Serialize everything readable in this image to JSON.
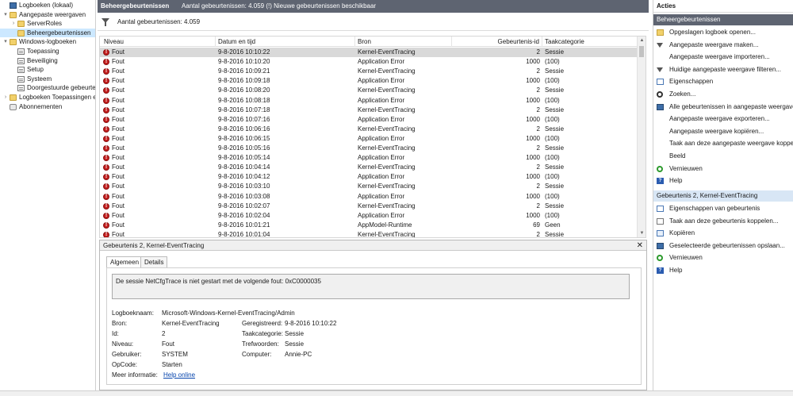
{
  "tree": {
    "items": [
      {
        "label": "Logboeken (lokaal)",
        "level": 0,
        "arrow": "",
        "icon": "root",
        "icon_name": "computer-icon"
      },
      {
        "label": "Aangepaste weergaven",
        "level": 0,
        "arrow": "▾",
        "icon": "folder",
        "icon_name": "folder-icon"
      },
      {
        "label": "ServerRoles",
        "level": 1,
        "arrow": "›",
        "icon": "folder",
        "icon_name": "folder-icon"
      },
      {
        "label": "Beheergebeurtenissen",
        "level": 1,
        "arrow": "",
        "icon": "folder",
        "icon_name": "filter-folder-icon",
        "selected": true
      },
      {
        "label": "Windows-logboeken",
        "level": 0,
        "arrow": "▾",
        "icon": "folder",
        "icon_name": "folder-icon"
      },
      {
        "label": "Toepassing",
        "level": 1,
        "arrow": "",
        "icon": "log",
        "icon_name": "log-icon"
      },
      {
        "label": "Beveiliging",
        "level": 1,
        "arrow": "",
        "icon": "log",
        "icon_name": "log-icon"
      },
      {
        "label": "Setup",
        "level": 1,
        "arrow": "",
        "icon": "log",
        "icon_name": "log-icon"
      },
      {
        "label": "Systeem",
        "level": 1,
        "arrow": "",
        "icon": "log",
        "icon_name": "log-icon"
      },
      {
        "label": "Doorgestuurde gebeurtenissen",
        "level": 1,
        "arrow": "",
        "icon": "log",
        "icon_name": "log-icon"
      },
      {
        "label": "Logboeken Toepassingen en services",
        "level": 0,
        "arrow": "›",
        "icon": "folder",
        "icon_name": "folder-icon"
      },
      {
        "label": "Abonnementen",
        "level": 0,
        "arrow": "",
        "icon": "sub",
        "icon_name": "subscription-icon"
      }
    ]
  },
  "center": {
    "title": "Beheergebeurtenissen",
    "title_info": "Aantal gebeurtenissen: 4.059 (!) Nieuwe gebeurtenissen beschikbaar",
    "filter_text": "Aantal gebeurtenissen: 4.059",
    "columns": [
      "Niveau",
      "Datum en tijd",
      "Bron",
      "Gebeurtenis-id",
      "Taakcategorie"
    ],
    "rows": [
      {
        "niveau": "Fout",
        "datum": "9-8-2016 10:10:22",
        "bron": "Kernel-EventTracing",
        "id": "2",
        "taak": "Sessie",
        "selected": true
      },
      {
        "niveau": "Fout",
        "datum": "9-8-2016 10:10:20",
        "bron": "Application Error",
        "id": "1000",
        "taak": "(100)"
      },
      {
        "niveau": "Fout",
        "datum": "9-8-2016 10:09:21",
        "bron": "Kernel-EventTracing",
        "id": "2",
        "taak": "Sessie"
      },
      {
        "niveau": "Fout",
        "datum": "9-8-2016 10:09:18",
        "bron": "Application Error",
        "id": "1000",
        "taak": "(100)"
      },
      {
        "niveau": "Fout",
        "datum": "9-8-2016 10:08:20",
        "bron": "Kernel-EventTracing",
        "id": "2",
        "taak": "Sessie"
      },
      {
        "niveau": "Fout",
        "datum": "9-8-2016 10:08:18",
        "bron": "Application Error",
        "id": "1000",
        "taak": "(100)"
      },
      {
        "niveau": "Fout",
        "datum": "9-8-2016 10:07:18",
        "bron": "Kernel-EventTracing",
        "id": "2",
        "taak": "Sessie"
      },
      {
        "niveau": "Fout",
        "datum": "9-8-2016 10:07:16",
        "bron": "Application Error",
        "id": "1000",
        "taak": "(100)"
      },
      {
        "niveau": "Fout",
        "datum": "9-8-2016 10:06:16",
        "bron": "Kernel-EventTracing",
        "id": "2",
        "taak": "Sessie"
      },
      {
        "niveau": "Fout",
        "datum": "9-8-2016 10:06:15",
        "bron": "Application Error",
        "id": "1000",
        "taak": "(100)"
      },
      {
        "niveau": "Fout",
        "datum": "9-8-2016 10:05:16",
        "bron": "Kernel-EventTracing",
        "id": "2",
        "taak": "Sessie"
      },
      {
        "niveau": "Fout",
        "datum": "9-8-2016 10:05:14",
        "bron": "Application Error",
        "id": "1000",
        "taak": "(100)"
      },
      {
        "niveau": "Fout",
        "datum": "9-8-2016 10:04:14",
        "bron": "Kernel-EventTracing",
        "id": "2",
        "taak": "Sessie"
      },
      {
        "niveau": "Fout",
        "datum": "9-8-2016 10:04:12",
        "bron": "Application Error",
        "id": "1000",
        "taak": "(100)"
      },
      {
        "niveau": "Fout",
        "datum": "9-8-2016 10:03:10",
        "bron": "Kernel-EventTracing",
        "id": "2",
        "taak": "Sessie"
      },
      {
        "niveau": "Fout",
        "datum": "9-8-2016 10:03:08",
        "bron": "Application Error",
        "id": "1000",
        "taak": "(100)"
      },
      {
        "niveau": "Fout",
        "datum": "9-8-2016 10:02:07",
        "bron": "Kernel-EventTracing",
        "id": "2",
        "taak": "Sessie"
      },
      {
        "niveau": "Fout",
        "datum": "9-8-2016 10:02:04",
        "bron": "Application Error",
        "id": "1000",
        "taak": "(100)"
      },
      {
        "niveau": "Fout",
        "datum": "9-8-2016 10:01:21",
        "bron": "AppModel-Runtime",
        "id": "69",
        "taak": "Geen"
      },
      {
        "niveau": "Fout",
        "datum": "9-8-2016 10:01:04",
        "bron": "Kernel-EventTracing",
        "id": "2",
        "taak": "Sessie"
      }
    ]
  },
  "detail": {
    "title": "Gebeurtenis 2, Kernel-EventTracing",
    "close": "✕",
    "tabs": [
      "Algemeen",
      "Details"
    ],
    "description": "De sessie NetCfgTrace is niet gestart met de volgende fout: 0xC0000035",
    "fields": {
      "logboeknaam_label": "Logboeknaam:",
      "logboeknaam": "Microsoft-Windows-Kernel-EventTracing/Admin",
      "bron_label": "Bron:",
      "bron": "Kernel-EventTracing",
      "geregistreerd_label": "Geregistreerd:",
      "geregistreerd": "9-8-2016 10:10:22",
      "id_label": "Id:",
      "id": "2",
      "taakcategorie_label": "Taakcategorie:",
      "taakcategorie": "Sessie",
      "niveau_label": "Niveau:",
      "niveau": "Fout",
      "trefwoorden_label": "Trefwoorden:",
      "trefwoorden": "Sessie",
      "gebruiker_label": "Gebruiker:",
      "gebruiker": "SYSTEM",
      "computer_label": "Computer:",
      "computer": "Annie-PC",
      "opcode_label": "OpCode:",
      "opcode": "Starten",
      "meer_label": "Meer informatie:",
      "meer_link": "Help online"
    }
  },
  "actions": {
    "title": "Acties",
    "section1": "Beheergebeurtenissen",
    "items1": [
      {
        "label": "Opgeslagen logboek openen...",
        "icon": "open",
        "icon_name": "open-log-icon"
      },
      {
        "label": "Aangepaste weergave maken...",
        "icon": "filter",
        "icon_name": "create-view-icon"
      },
      {
        "label": "Aangepaste weergave importeren...",
        "icon": "none",
        "icon_name": ""
      },
      {
        "label": "Huidige aangepaste weergave filteren...",
        "icon": "filter",
        "icon_name": "filter-icon"
      },
      {
        "label": "Eigenschappen",
        "icon": "props",
        "icon_name": "properties-icon"
      },
      {
        "label": "Zoeken...",
        "icon": "find",
        "icon_name": "binoculars-icon"
      },
      {
        "label": "Alle gebeurtenissen in aangepaste weergave opslaan...",
        "icon": "save",
        "icon_name": "save-icon"
      },
      {
        "label": "Aangepaste weergave exporteren...",
        "icon": "none",
        "icon_name": ""
      },
      {
        "label": "Aangepaste weergave kopiëren...",
        "icon": "none",
        "icon_name": ""
      },
      {
        "label": "Taak aan deze aangepaste weergave koppelen...",
        "icon": "none",
        "icon_name": ""
      },
      {
        "label": "Beeld",
        "icon": "none",
        "icon_name": ""
      },
      {
        "label": "Vernieuwen",
        "icon": "refresh",
        "icon_name": "refresh-icon"
      },
      {
        "label": "Help",
        "icon": "help",
        "icon_name": "help-icon"
      }
    ],
    "section2": "Gebeurtenis 2, Kernel-EventTracing",
    "items2": [
      {
        "label": "Eigenschappen van gebeurtenis",
        "icon": "props",
        "icon_name": "event-properties-icon"
      },
      {
        "label": "Taak aan deze gebeurtenis koppelen...",
        "icon": "task",
        "icon_name": "task-icon"
      },
      {
        "label": "Kopiëren",
        "icon": "copy",
        "icon_name": "copy-icon"
      },
      {
        "label": "Geselecteerde gebeurtenissen opslaan...",
        "icon": "save",
        "icon_name": "save-icon"
      },
      {
        "label": "Vernieuwen",
        "icon": "refresh",
        "icon_name": "refresh-icon"
      },
      {
        "label": "Help",
        "icon": "help",
        "icon_name": "help-icon"
      }
    ]
  }
}
